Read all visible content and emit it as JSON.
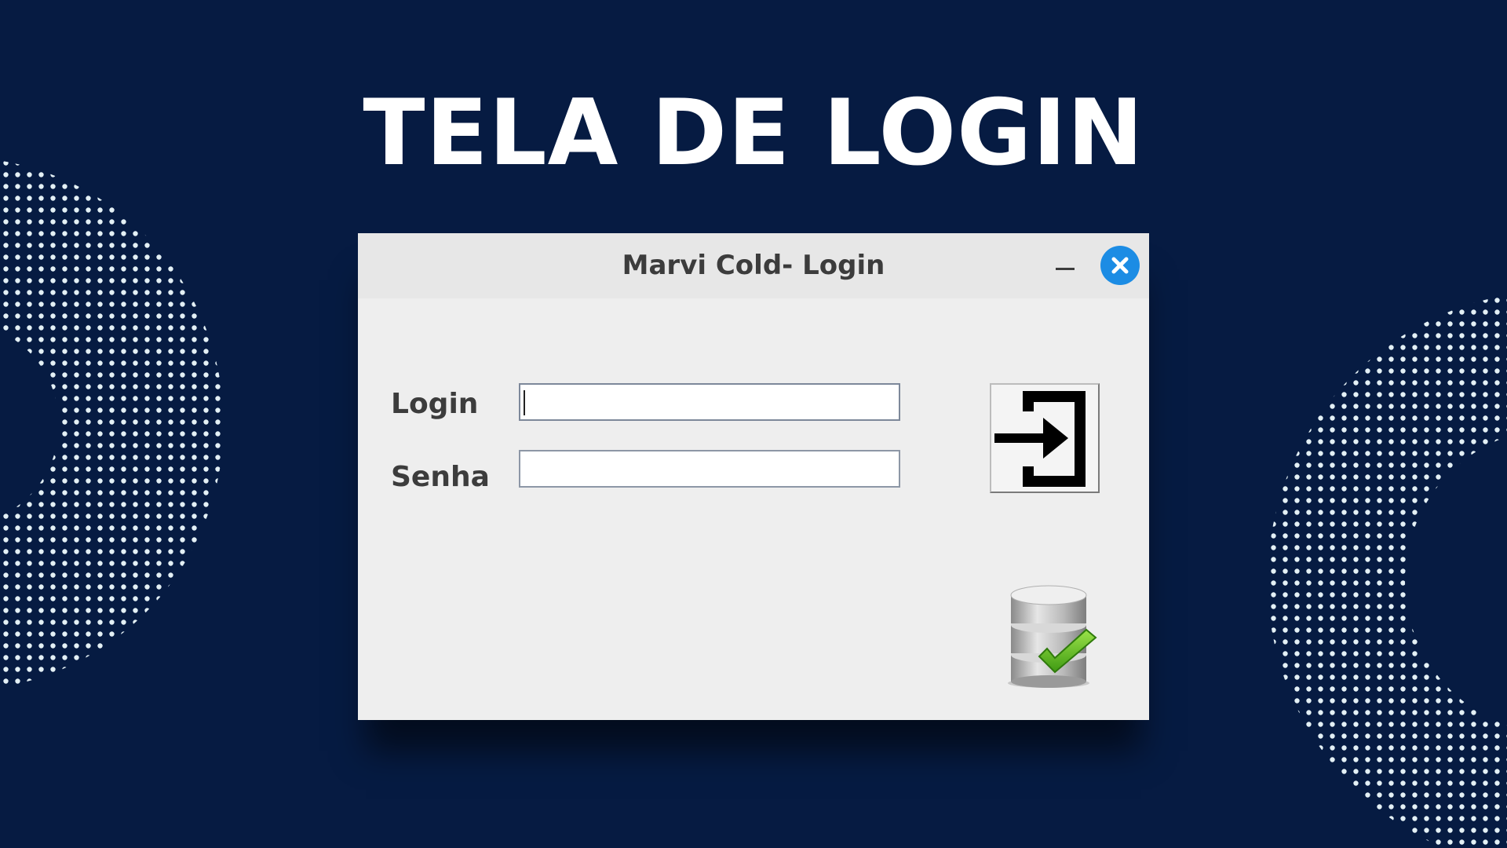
{
  "headline": "TELA DE LOGIN",
  "window": {
    "title": "Marvi Cold- Login",
    "controls": {
      "minimize_icon": "minimize-icon",
      "close_icon": "close-icon"
    }
  },
  "form": {
    "login_label": "Login",
    "login_value": "",
    "senha_label": "Senha",
    "senha_value": "",
    "enter_icon": "login-enter-icon",
    "status_icon": "database-check-icon"
  },
  "colors": {
    "background": "#061b42",
    "window": "#eeeeee",
    "titlebar": "#e7e7e7",
    "close_button": "#1c8ce4",
    "check": "#5fbf1a",
    "dots": "#e3f0f5"
  }
}
